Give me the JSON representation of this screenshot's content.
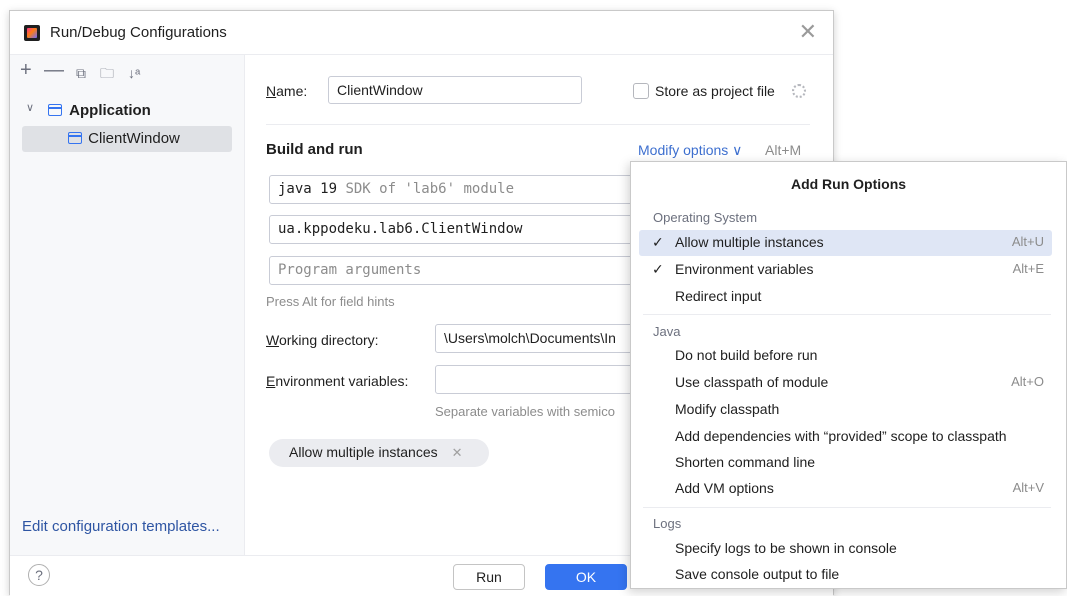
{
  "window": {
    "title": "Run/Debug Configurations"
  },
  "sidebar": {
    "toolbar": [
      "add-icon",
      "remove-icon",
      "copy-icon",
      "new-folder-icon",
      "sort-icon"
    ],
    "tree_group": "Application",
    "tree_item": "ClientWindow",
    "edit_templates": "Edit configuration templates..."
  },
  "form": {
    "name_label": "Name:",
    "name_value": "ClientWindow",
    "store_label": "Store as project file",
    "build_run_title": "Build and run",
    "modify_options": "Modify options",
    "modify_shortcut": "Alt+M",
    "sdk_bold": "java 19",
    "sdk_rest": "SDK of 'lab6' module",
    "main_class": "ua.kppodeku.lab6.ClientWindow",
    "program_args_placeholder": "Program arguments",
    "field_hint": "Press Alt for field hints",
    "working_dir_label": "Working directory:",
    "working_dir_value": "\\Users\\molch\\Documents\\In",
    "env_vars_label": "Environment variables:",
    "env_vars_value": "",
    "env_hint": "Separate variables with semico",
    "chip_label": "Allow multiple instances"
  },
  "footer": {
    "help": "?",
    "run_button": "Run",
    "ok_button": "OK"
  },
  "popup": {
    "title": "Add Run Options",
    "groups": [
      {
        "heading": "Operating System",
        "items": [
          {
            "label": "Allow multiple instances",
            "checked": "✓",
            "shortcut": "Alt+U"
          },
          {
            "label": "Environment variables",
            "checked": "✓",
            "shortcut": "Alt+E"
          },
          {
            "label": "Redirect input",
            "checked": "",
            "shortcut": ""
          }
        ]
      },
      {
        "heading": "Java",
        "items": [
          {
            "label": "Do not build before run",
            "checked": "",
            "shortcut": ""
          },
          {
            "label": "Use classpath of module",
            "checked": "",
            "shortcut": "Alt+O"
          },
          {
            "label": "Modify classpath",
            "checked": "",
            "shortcut": ""
          },
          {
            "label": "Add dependencies with “provided” scope to classpath",
            "checked": "",
            "shortcut": ""
          },
          {
            "label": "Shorten command line",
            "checked": "",
            "shortcut": ""
          },
          {
            "label": "Add VM options",
            "checked": "",
            "shortcut": "Alt+V"
          }
        ]
      },
      {
        "heading": "Logs",
        "items": [
          {
            "label": "Specify logs to be shown in console",
            "checked": "",
            "shortcut": ""
          },
          {
            "label": "Save console output to file",
            "checked": "",
            "shortcut": ""
          }
        ]
      }
    ]
  }
}
